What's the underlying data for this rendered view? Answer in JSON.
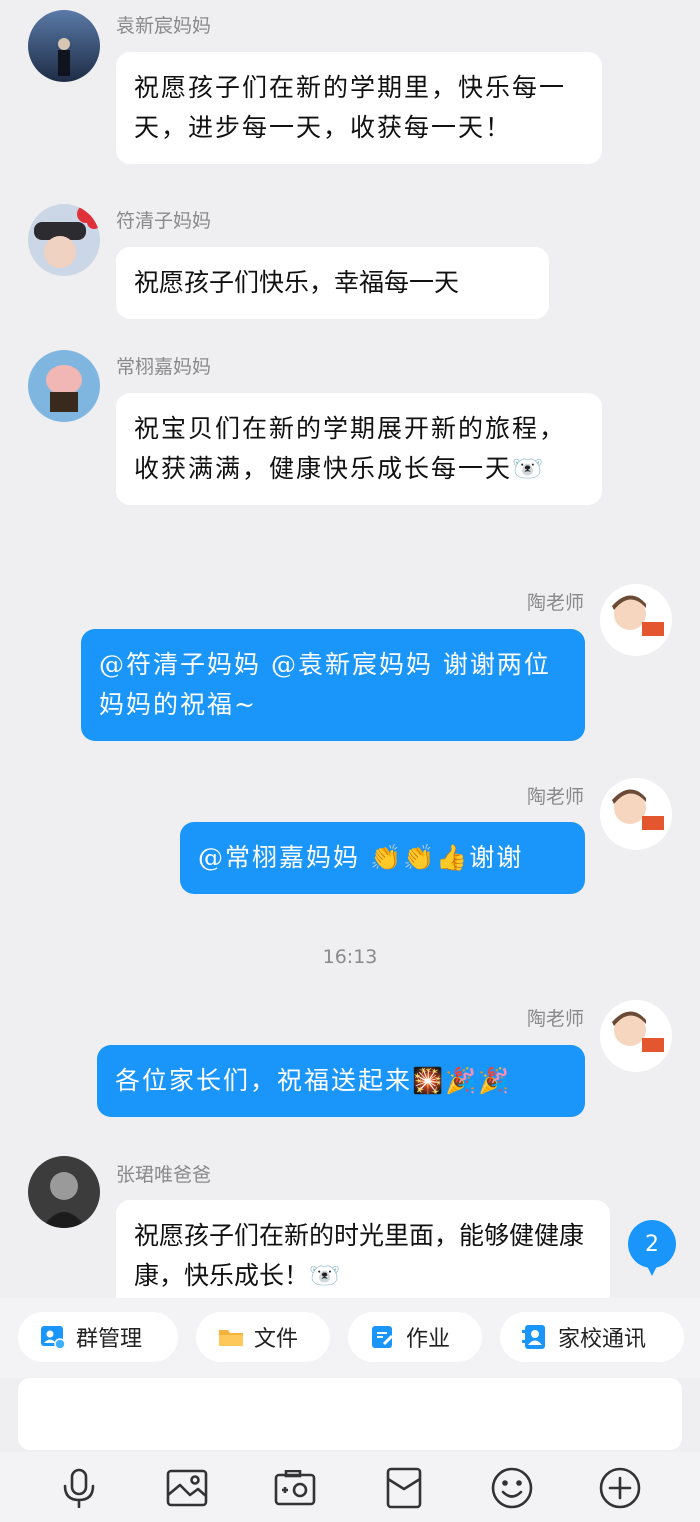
{
  "messages": [
    {
      "sender": "袁新宸妈妈",
      "text": "祝愿孩子们在新的学期里，快乐每一天，进步每一天，收获每一天！"
    },
    {
      "sender": "符清子妈妈",
      "text": "祝愿孩子们快乐，幸福每一天"
    },
    {
      "sender": "常栩嘉妈妈",
      "text": "祝宝贝们在新的学期展开新的旅程，收获满满，健康快乐成长每一天🐻‍❄️"
    },
    {
      "sender": "陶老师",
      "text": "@符清子妈妈 @袁新宸妈妈 谢谢两位妈妈的祝福~"
    },
    {
      "sender": "陶老师",
      "text": "@常栩嘉妈妈 👏👏👍谢谢"
    },
    {
      "sender": "陶老师",
      "text": "各位家长们，祝福送起来🎇🎉🎉"
    },
    {
      "sender": "张珺唯爸爸",
      "text": "祝愿孩子们在新的时光里面，能够健健康康，快乐成长！🐻‍❄️"
    }
  ],
  "timestamp": "16:13",
  "unread_count": "2",
  "quick_actions": [
    {
      "label": "群管理",
      "icon": "group-manage-icon"
    },
    {
      "label": "文件",
      "icon": "folder-icon"
    },
    {
      "label": "作业",
      "icon": "homework-icon"
    },
    {
      "label": "家校通讯",
      "icon": "contacts-icon"
    }
  ],
  "toolbar": [
    "microphone-icon",
    "image-icon",
    "camera-icon",
    "red-packet-icon",
    "emoji-icon",
    "plus-icon"
  ],
  "colors": {
    "accent": "#1a96fb",
    "background": "#efeff1"
  }
}
